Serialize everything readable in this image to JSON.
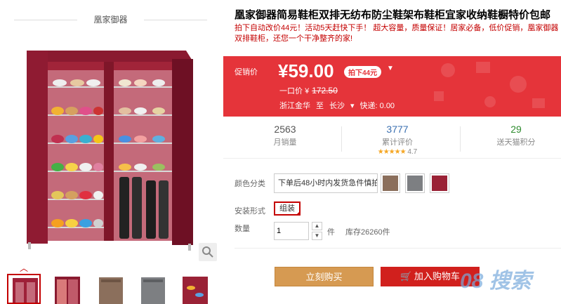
{
  "brand": "凰家御器",
  "product": {
    "title": "凰家御器简易鞋柜双排无纺布防尘鞋架布鞋柜宜家收纳鞋橱特价包邮",
    "subtitle": "拍下自动改价44元！活动5天赶快下手！ 超大容量，质量保证！居家必备，低价促销，凰家御器双排鞋柜，还您一个干净整齐的家!"
  },
  "price": {
    "label": "促销价",
    "currency": "¥",
    "value": "59.00",
    "deal_badge": "拍下44元",
    "original_label": "一口价",
    "original_currency": "¥",
    "original_value": "172.50",
    "ship_from": "浙江金华",
    "ship_to_label": "至",
    "ship_to": "长沙",
    "express": "快递: 0.00"
  },
  "stats": [
    {
      "value": "2563",
      "label": "月销量",
      "color": "#555555"
    },
    {
      "value": "3777",
      "label": "累计评价",
      "color": "#3a6fb0",
      "stars": "★★★★★",
      "rating": "4.7"
    },
    {
      "value": "29",
      "label": "送天猫积分",
      "color": "#2e8b2e"
    }
  ],
  "options": {
    "color_label": "颜色分类",
    "color_selected": "下单后48小时内发货急件慎拍",
    "swatches": [
      "#8b6f5c",
      "#7d7f82",
      "#9a2236"
    ],
    "install_label": "安装形式",
    "install_value": "组装",
    "qty_label": "数量",
    "qty_value": "1",
    "qty_unit": "件",
    "stock": "库存26260件"
  },
  "buttons": {
    "buy": "立刻购买",
    "cart": "加入购物车"
  },
  "watermark": "08 搜索",
  "colors": {
    "accent": "#c40000",
    "price_bg": "#e5343a",
    "buy_bg": "#d69a52",
    "cart_bg": "#d1201d"
  }
}
